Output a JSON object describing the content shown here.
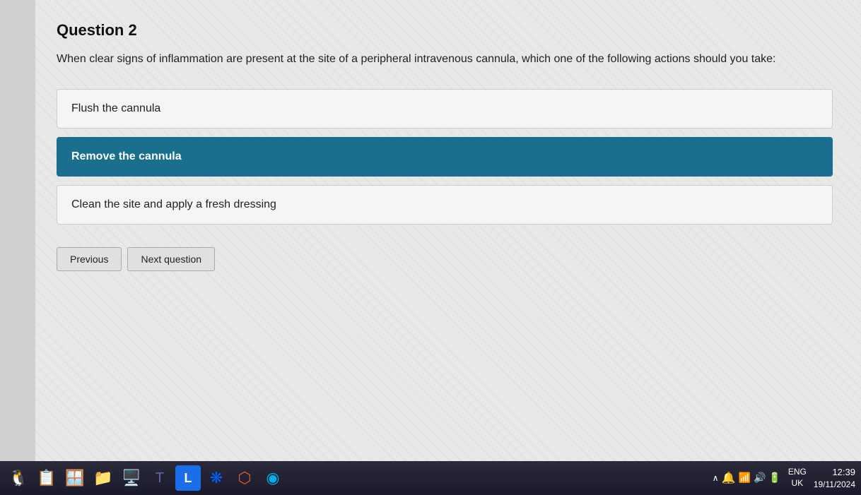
{
  "question": {
    "number": "Question 2",
    "text": "When clear signs of inflammation are present at the site of a peripheral intravenous cannula, which one of the following actions should you take:",
    "options": [
      {
        "id": "option-1",
        "label": "Flush the cannula",
        "selected": false
      },
      {
        "id": "option-2",
        "label": "Remove the cannula",
        "selected": true
      },
      {
        "id": "option-3",
        "label": "Clean the site and apply a fresh dressing",
        "selected": false
      }
    ]
  },
  "buttons": {
    "previous": "Previous",
    "next": "Next question"
  },
  "taskbar": {
    "icons": [
      "🐧",
      "📋",
      "🪟",
      "📁",
      "🖥️",
      "👥",
      "🔵",
      "❋",
      "🎮",
      "🌐"
    ],
    "lang": "ENG\nUK",
    "time": "12:39",
    "date": "19/11/2024"
  }
}
